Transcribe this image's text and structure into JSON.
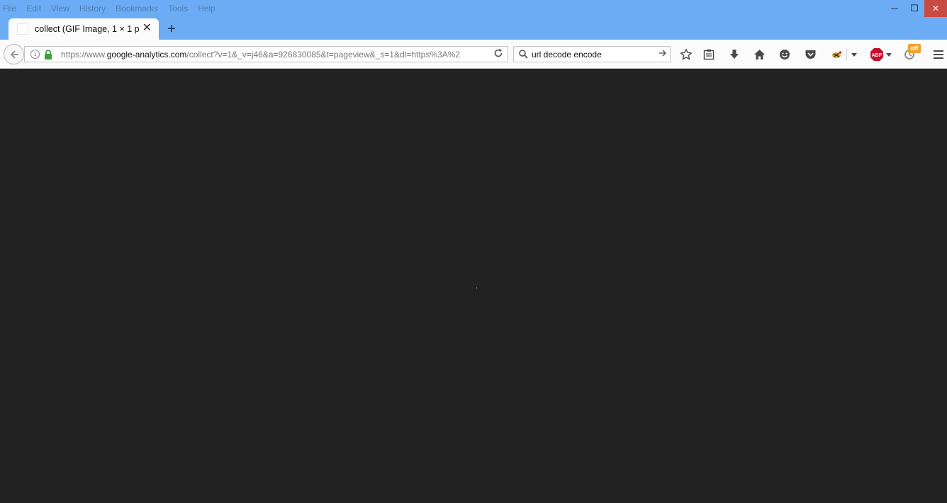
{
  "menubar": {
    "items": [
      "File",
      "Edit",
      "View",
      "History",
      "Bookmarks",
      "Tools",
      "Help"
    ]
  },
  "tab": {
    "title": "collect (GIF Image, 1 × 1 p...",
    "close": "✕"
  },
  "newtab": {
    "label": "+"
  },
  "navbar": {
    "url_prefix": "https://www.",
    "url_host": "google-analytics.com",
    "url_rest": "/collect?v=1&_v=j46&a=926830085&t=pageview&_s=1&dl=https%3A%2",
    "search_value": "url decode encode"
  },
  "toolbar": {
    "counter_badge": "off"
  },
  "window_controls": {
    "minimize": "—",
    "maximize": "☐",
    "close": "✕"
  },
  "icons": [
    "back-arrow-icon",
    "info-icon",
    "lock-icon",
    "reload-icon",
    "search-icon",
    "go-arrow-icon",
    "bookmark-star-icon",
    "reading-list-icon",
    "download-icon",
    "home-icon",
    "hello-icon",
    "pocket-icon",
    "extension-icon",
    "abp-icon",
    "counter-icon",
    "hamburger-menu-icon"
  ],
  "colors": {
    "titlebar": "#6bacf4",
    "content_background": "#222222",
    "close_button": "#c84b43",
    "lock_green": "#3ea23a",
    "abp_red": "#c70d2c",
    "badge_orange": "#f0a030"
  }
}
